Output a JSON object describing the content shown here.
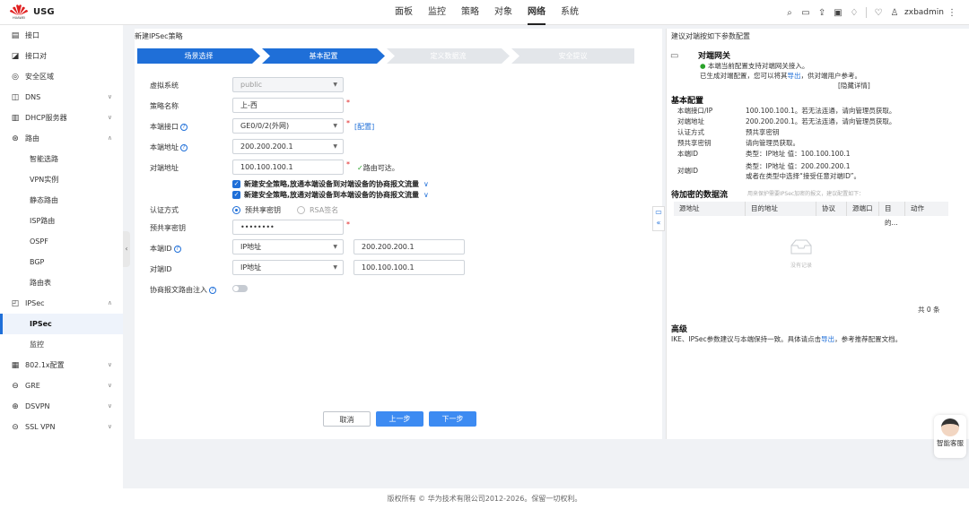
{
  "brand": {
    "logo_text": "HUAWEI",
    "name": "USG"
  },
  "nav": [
    "面板",
    "监控",
    "策略",
    "对象",
    "网络",
    "系统"
  ],
  "toolbar": {
    "more": "⋮",
    "user": "zxbadmin"
  },
  "sidebar": [
    {
      "label": "接口",
      "icon": "interface-icon",
      "chev": ""
    },
    {
      "label": "接口对",
      "icon": "interface-pair-icon",
      "chev": ""
    },
    {
      "label": "安全区域",
      "icon": "zone-icon",
      "chev": ""
    },
    {
      "label": "DNS",
      "icon": "dns-icon",
      "chev": "∨"
    },
    {
      "label": "DHCP服务器",
      "icon": "dhcp-icon",
      "chev": "∨"
    },
    {
      "label": "路由",
      "icon": "route-icon",
      "chev": "∧"
    },
    {
      "label": "智能选路",
      "sub": true
    },
    {
      "label": "VPN实例",
      "sub": true
    },
    {
      "label": "静态路由",
      "sub": true
    },
    {
      "label": "ISP路由",
      "sub": true
    },
    {
      "label": "OSPF",
      "sub": true
    },
    {
      "label": "BGP",
      "sub": true
    },
    {
      "label": "路由表",
      "sub": true
    },
    {
      "label": "IPSec",
      "icon": "ipsec-icon",
      "chev": "∧"
    },
    {
      "label": "IPSec",
      "sub": true,
      "active": true
    },
    {
      "label": "监控",
      "sub": true
    },
    {
      "label": "802.1x配置",
      "icon": "dot1x-icon",
      "chev": "∨"
    },
    {
      "label": "GRE",
      "icon": "gre-icon",
      "chev": "∨"
    },
    {
      "label": "DSVPN",
      "icon": "dsvpn-icon",
      "chev": "∨"
    },
    {
      "label": "SSL VPN",
      "icon": "sslvpn-icon",
      "chev": "∨"
    }
  ],
  "page_title": "新建IPSec策略",
  "steps": [
    "场景选择",
    "基本配置",
    "定义数据流",
    "安全提议"
  ],
  "form": {
    "vsys_label": "虚拟系统",
    "vsys_value": "public",
    "policy_label": "策略名称",
    "policy_value": "上-西",
    "local_if_label": "本端接口",
    "local_if_value": "GE0/0/2(外网)",
    "config_link": "[配置]",
    "local_addr_label": "本端地址",
    "local_addr_value": "200.200.200.1",
    "peer_addr_label": "对端地址",
    "peer_addr_value": "100.100.100.1",
    "route_ok": "路由可达。",
    "cb1": "新建安全策略,放通本端设备到对端设备的协商报文流量",
    "cb2": "新建安全策略,放通对端设备到本端设备的协商报文流量",
    "auth_label": "认证方式",
    "auth_psk": "预共享密钥",
    "auth_rsa": "RSA签名",
    "psk_label": "预共享密钥",
    "psk_value": "••••••••",
    "local_id_label": "本端ID",
    "local_id_type": "IP地址",
    "local_id_value": "200.200.200.1",
    "peer_id_label": "对端ID",
    "peer_id_type": "IP地址",
    "peer_id_value": "100.100.100.1",
    "route_inject_label": "协商报文路由注入"
  },
  "buttons": {
    "cancel": "取消",
    "prev": "上一步",
    "next": "下一步"
  },
  "right": {
    "title": "建议对端按如下参数配置",
    "gw_title": "对端网关",
    "gw_line1": "本端当前配置支持对端网关接入。",
    "gw_line2_pre": "已生成对端配置，您可以将其",
    "export": "导出",
    "gw_line2_post": "，供对端用户参考。",
    "hide": "[隐藏详情]",
    "basic_title": "基本配置",
    "basic": [
      {
        "k": "本端接口/IP",
        "v": "100.100.100.1。若无法连通，请向管理员获取。"
      },
      {
        "k": "对端地址",
        "v": "200.200.200.1。若无法连通，请向管理员获取。"
      },
      {
        "k": "认证方式",
        "v": "预共享密钥"
      },
      {
        "k": "预共享密钥",
        "v": "请向管理员获取。"
      },
      {
        "k": "本端ID",
        "v": "类型：IP地址 值：100.100.100.1"
      },
      {
        "k": "对端ID",
        "v": "类型：IP地址 值：200.200.200.1"
      }
    ],
    "peer_id_extra": "或者在类型中选择“接受任意对端ID”。",
    "flow_title": "待加密的数据流",
    "flow_note": "用来保护需要IPSec加密的报文，建议配置如下：",
    "cols": [
      "源地址",
      "目的地址",
      "协议",
      "源端口",
      "目的...",
      "动作"
    ],
    "empty": "没有记录",
    "total": "共 0 条",
    "adv_title": "高级",
    "adv_pre": "IKE、IPSec参数建议与本端保持一致。具体请点击",
    "adv_link": "导出",
    "adv_post": "，参考推荐配置文档。"
  },
  "assistant": "智能客服",
  "footer": "版权所有 © 华为技术有限公司2012-2026。保留一切权利。"
}
